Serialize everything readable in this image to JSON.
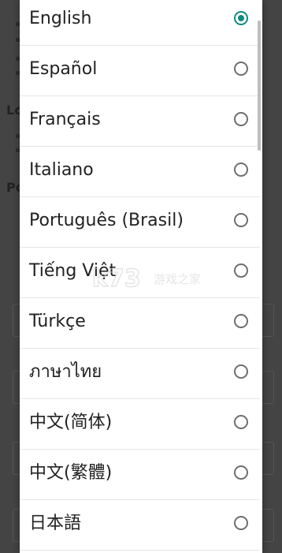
{
  "dialog": {
    "items": [
      {
        "label": "English",
        "selected": true
      },
      {
        "label": "Español",
        "selected": false
      },
      {
        "label": "Français",
        "selected": false
      },
      {
        "label": "Italiano",
        "selected": false
      },
      {
        "label": "Português (Brasil)",
        "selected": false
      },
      {
        "label": "Tiếng Việt",
        "selected": false
      },
      {
        "label": "Türkçe",
        "selected": false
      },
      {
        "label": "ภาษาไทย",
        "selected": false
      },
      {
        "label": "中文(简体)",
        "selected": false
      },
      {
        "label": "中文(繁體)",
        "selected": false
      },
      {
        "label": "日本語",
        "selected": false
      }
    ]
  },
  "background": {
    "fragments": [
      "Lo",
      "Po"
    ]
  },
  "watermark": {
    "text": "k73 游戏之家"
  },
  "colors": {
    "accent": "#0f8a82",
    "radio_unselected": "#6e6e6e",
    "overlay": "#3f3f3f"
  }
}
